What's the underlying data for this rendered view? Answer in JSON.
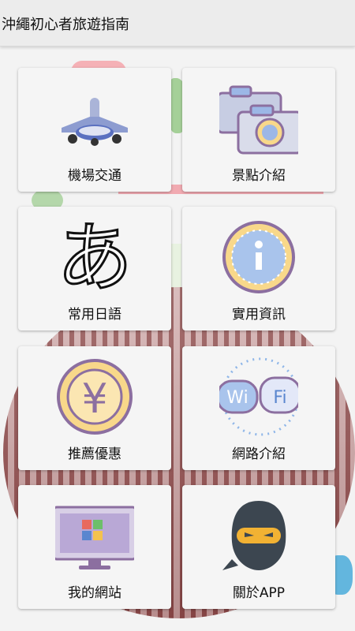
{
  "app": {
    "title": "沖繩初心者旅遊指南"
  },
  "menu": [
    {
      "label": "機場交通",
      "icon": "airplane-icon"
    },
    {
      "label": "景點介紹",
      "icon": "camera-icon"
    },
    {
      "label": "常用日語",
      "icon": "hiragana-a-icon",
      "glyph": "あ"
    },
    {
      "label": "實用資訊",
      "icon": "info-icon"
    },
    {
      "label": "推薦優惠",
      "icon": "yen-coin-icon",
      "glyph": "¥"
    },
    {
      "label": "網路介紹",
      "icon": "wifi-icon",
      "glyph_left": "Wi",
      "glyph_right": "Fi"
    },
    {
      "label": "我的網站",
      "icon": "monitor-icon"
    },
    {
      "label": "關於APP",
      "icon": "ninja-icon"
    }
  ]
}
